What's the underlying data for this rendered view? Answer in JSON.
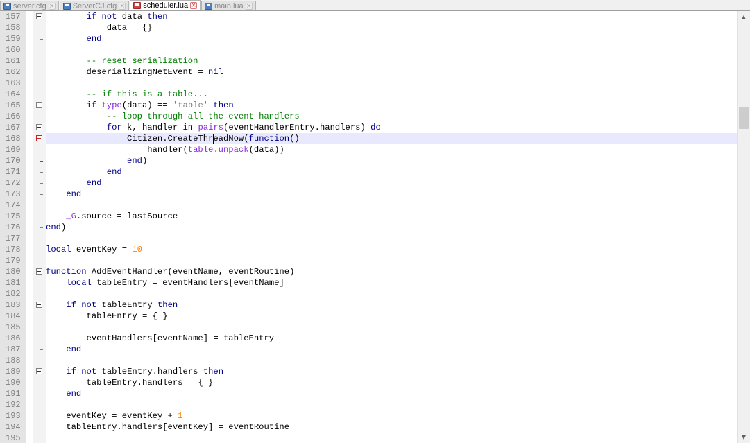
{
  "tabs": [
    {
      "label": "server.cfg",
      "active": false,
      "modified": false
    },
    {
      "label": "ServerCJ.cfg",
      "active": false,
      "modified": false
    },
    {
      "label": "scheduler.lua",
      "active": true,
      "modified": true
    },
    {
      "label": "main.lua",
      "active": false,
      "modified": false
    }
  ],
  "icons": {
    "file": "file-icon",
    "close": "close-icon",
    "fold": "fold-minus-icon",
    "scroll_up": "scroll-up-arrow-icon",
    "scroll_down": "scroll-down-arrow-icon"
  },
  "colors": {
    "keyword": "#00008b",
    "builtin": "#8a2be2",
    "number": "#ff8000",
    "string": "#808080",
    "comment": "#008000",
    "current_line": "#e8e8ff"
  },
  "current_line": "168",
  "lines": [
    {
      "n": "157",
      "fold": "box",
      "segs": [
        [
          "        ",
          ""
        ],
        [
          "if",
          "kw"
        ],
        [
          " ",
          ""
        ],
        [
          "not",
          "kw"
        ],
        [
          " data ",
          ""
        ],
        [
          "then",
          "kw"
        ]
      ]
    },
    {
      "n": "158",
      "fold": "bar",
      "segs": [
        [
          "            data = {}",
          ""
        ]
      ]
    },
    {
      "n": "159",
      "fold": "end",
      "segs": [
        [
          "        ",
          ""
        ],
        [
          "end",
          "kw"
        ]
      ]
    },
    {
      "n": "160",
      "fold": "bar",
      "segs": []
    },
    {
      "n": "161",
      "fold": "bar",
      "segs": [
        [
          "        ",
          ""
        ],
        [
          "-- reset serialization",
          "cm"
        ]
      ]
    },
    {
      "n": "162",
      "fold": "bar",
      "segs": [
        [
          "        deserializingNetEvent = ",
          ""
        ],
        [
          "nil",
          "kw"
        ]
      ]
    },
    {
      "n": "163",
      "fold": "bar",
      "segs": []
    },
    {
      "n": "164",
      "fold": "bar",
      "segs": [
        [
          "        ",
          ""
        ],
        [
          "-- if this is a table...",
          "cm"
        ]
      ]
    },
    {
      "n": "165",
      "fold": "box",
      "segs": [
        [
          "        ",
          ""
        ],
        [
          "if",
          "kw"
        ],
        [
          " ",
          ""
        ],
        [
          "type",
          "fn"
        ],
        [
          "(data) == ",
          ""
        ],
        [
          "'table'",
          "str"
        ],
        [
          " ",
          ""
        ],
        [
          "then",
          "kw"
        ]
      ]
    },
    {
      "n": "166",
      "fold": "bar",
      "segs": [
        [
          "            ",
          ""
        ],
        [
          "-- loop through all the event handlers",
          "cm"
        ]
      ]
    },
    {
      "n": "167",
      "fold": "box",
      "segs": [
        [
          "            ",
          ""
        ],
        [
          "for",
          "kw"
        ],
        [
          " k, handler ",
          ""
        ],
        [
          "in",
          "kw"
        ],
        [
          " ",
          ""
        ],
        [
          "pairs",
          "fn"
        ],
        [
          "(eventHandlerEntry.handlers) ",
          ""
        ],
        [
          "do",
          "kw"
        ]
      ]
    },
    {
      "n": "168",
      "fold": "redbox",
      "segs": [
        [
          "                Citizen.CreateThr",
          ""
        ],
        [
          "|caret",
          ""
        ],
        [
          "eadNow(",
          ""
        ],
        [
          "function",
          "kw"
        ],
        [
          "()",
          ""
        ]
      ]
    },
    {
      "n": "169",
      "fold": "redbar",
      "segs": [
        [
          "                    handler(",
          ""
        ],
        [
          "table.unpack",
          "fn"
        ],
        [
          "(data))",
          ""
        ]
      ]
    },
    {
      "n": "170",
      "fold": "redend",
      "segs": [
        [
          "                ",
          ""
        ],
        [
          "end",
          "kw"
        ],
        [
          ")",
          ""
        ]
      ]
    },
    {
      "n": "171",
      "fold": "end",
      "segs": [
        [
          "            ",
          ""
        ],
        [
          "end",
          "kw"
        ]
      ]
    },
    {
      "n": "172",
      "fold": "end",
      "segs": [
        [
          "        ",
          ""
        ],
        [
          "end",
          "kw"
        ]
      ]
    },
    {
      "n": "173",
      "fold": "end",
      "segs": [
        [
          "    ",
          ""
        ],
        [
          "end",
          "kw"
        ]
      ]
    },
    {
      "n": "174",
      "fold": "bar",
      "segs": []
    },
    {
      "n": "175",
      "fold": "bar",
      "segs": [
        [
          "    ",
          ""
        ],
        [
          "_G",
          "g"
        ],
        [
          ".source = lastSource",
          ""
        ]
      ]
    },
    {
      "n": "176",
      "fold": "endlast",
      "segs": [
        [
          "",
          ""
        ],
        [
          "end",
          "kw"
        ],
        [
          ")",
          ""
        ]
      ]
    },
    {
      "n": "177",
      "fold": "none",
      "segs": []
    },
    {
      "n": "178",
      "fold": "none",
      "segs": [
        [
          "",
          ""
        ],
        [
          "local",
          "kw"
        ],
        [
          " eventKey = ",
          ""
        ],
        [
          "10",
          "num"
        ]
      ]
    },
    {
      "n": "179",
      "fold": "none",
      "segs": []
    },
    {
      "n": "180",
      "fold": "boxtop",
      "segs": [
        [
          "",
          ""
        ],
        [
          "function",
          "kw"
        ],
        [
          " AddEventHandler(eventName, eventRoutine)",
          ""
        ]
      ]
    },
    {
      "n": "181",
      "fold": "bar",
      "segs": [
        [
          "    ",
          ""
        ],
        [
          "local",
          "kw"
        ],
        [
          " tableEntry = eventHandlers[eventName]",
          ""
        ]
      ]
    },
    {
      "n": "182",
      "fold": "bar",
      "segs": []
    },
    {
      "n": "183",
      "fold": "box",
      "segs": [
        [
          "    ",
          ""
        ],
        [
          "if",
          "kw"
        ],
        [
          " ",
          ""
        ],
        [
          "not",
          "kw"
        ],
        [
          " tableEntry ",
          ""
        ],
        [
          "then",
          "kw"
        ]
      ]
    },
    {
      "n": "184",
      "fold": "bar",
      "segs": [
        [
          "        tableEntry = { }",
          ""
        ]
      ]
    },
    {
      "n": "185",
      "fold": "bar",
      "segs": []
    },
    {
      "n": "186",
      "fold": "bar",
      "segs": [
        [
          "        eventHandlers[eventName] = tableEntry",
          ""
        ]
      ]
    },
    {
      "n": "187",
      "fold": "end",
      "segs": [
        [
          "    ",
          ""
        ],
        [
          "end",
          "kw"
        ]
      ]
    },
    {
      "n": "188",
      "fold": "bar",
      "segs": []
    },
    {
      "n": "189",
      "fold": "box",
      "segs": [
        [
          "    ",
          ""
        ],
        [
          "if",
          "kw"
        ],
        [
          " ",
          ""
        ],
        [
          "not",
          "kw"
        ],
        [
          " tableEntry.handlers ",
          ""
        ],
        [
          "then",
          "kw"
        ]
      ]
    },
    {
      "n": "190",
      "fold": "bar",
      "segs": [
        [
          "        tableEntry.handlers = { }",
          ""
        ]
      ]
    },
    {
      "n": "191",
      "fold": "end",
      "segs": [
        [
          "    ",
          ""
        ],
        [
          "end",
          "kw"
        ]
      ]
    },
    {
      "n": "192",
      "fold": "bar",
      "segs": []
    },
    {
      "n": "193",
      "fold": "bar",
      "segs": [
        [
          "    eventKey = eventKey + ",
          ""
        ],
        [
          "1",
          "num"
        ]
      ]
    },
    {
      "n": "194",
      "fold": "bar",
      "segs": [
        [
          "    tableEntry.handlers[eventKey] = eventRoutine",
          ""
        ]
      ]
    },
    {
      "n": "195",
      "fold": "bar",
      "segs": []
    }
  ]
}
